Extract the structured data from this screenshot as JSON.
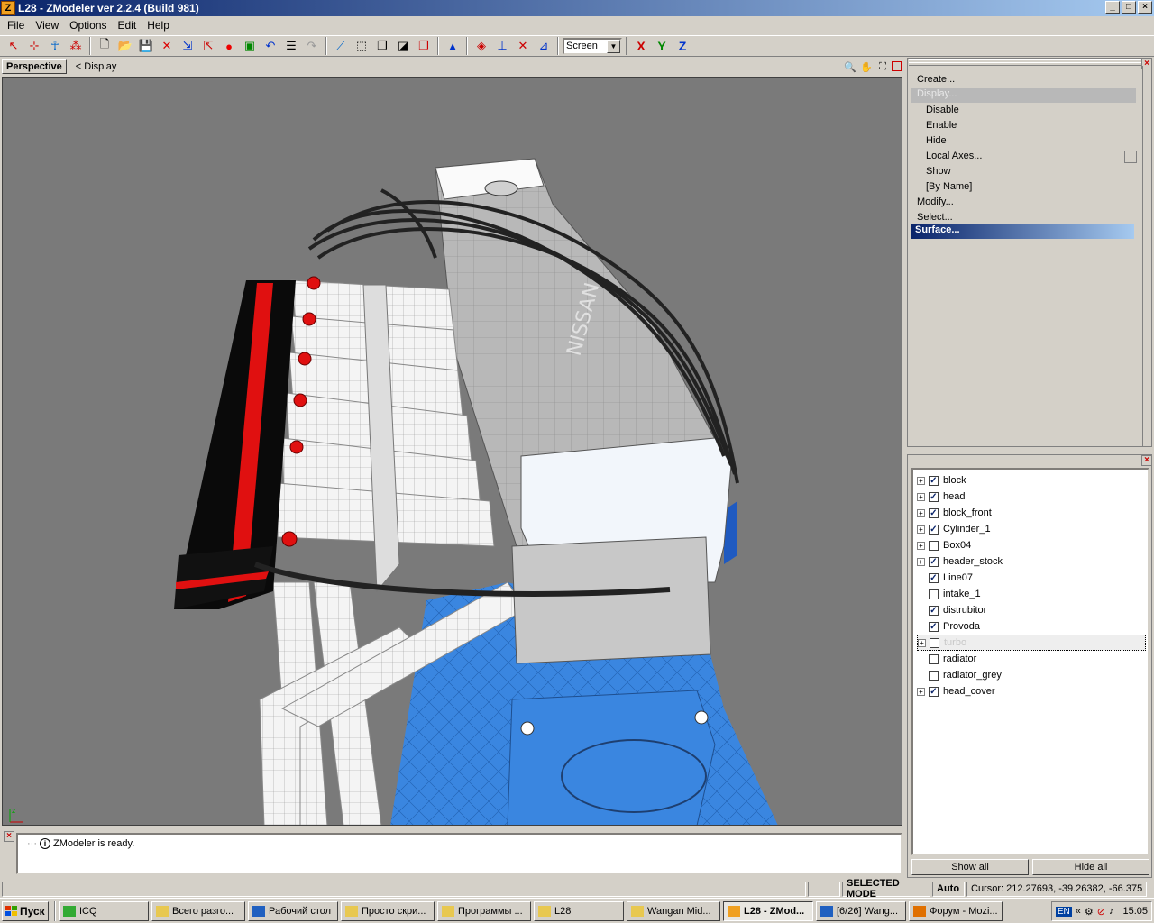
{
  "window": {
    "title": "L28 - ZModeler ver 2.2.4 (Build 981)",
    "app_icon": "Z"
  },
  "menubar": [
    "File",
    "View",
    "Options",
    "Edit",
    "Help"
  ],
  "toolbar": {
    "view_combo": "Screen",
    "axis_x": "X",
    "axis_y": "Y",
    "axis_z": "Z"
  },
  "viewport": {
    "tab": "Perspective",
    "crumb": "<  Display"
  },
  "command_panel": {
    "items": [
      {
        "label": "Create...",
        "indent": false
      },
      {
        "label": "Display...",
        "indent": false,
        "dim": true
      },
      {
        "label": "Disable",
        "indent": true
      },
      {
        "label": "Enable",
        "indent": true
      },
      {
        "label": "Hide",
        "indent": true
      },
      {
        "label": "Local Axes...",
        "indent": true
      },
      {
        "label": "Show",
        "indent": true
      },
      {
        "label": "[By Name]",
        "indent": true
      },
      {
        "label": "Modify...",
        "indent": false
      },
      {
        "label": "Select...",
        "indent": false
      },
      {
        "label": "Surface...",
        "indent": false,
        "selected": true
      }
    ]
  },
  "objects": [
    {
      "name": "block",
      "expand": true,
      "checked": true
    },
    {
      "name": "head",
      "expand": true,
      "checked": true
    },
    {
      "name": "block_front",
      "expand": true,
      "checked": true
    },
    {
      "name": "Cylinder_1",
      "expand": true,
      "checked": true
    },
    {
      "name": "Box04",
      "expand": true,
      "checked": false
    },
    {
      "name": "header_stock",
      "expand": true,
      "checked": true
    },
    {
      "name": "Line07",
      "expand": false,
      "checked": true
    },
    {
      "name": "intake_1",
      "expand": false,
      "checked": false
    },
    {
      "name": "distrubitor",
      "expand": false,
      "checked": true
    },
    {
      "name": "Provoda",
      "expand": false,
      "checked": true
    },
    {
      "name": "turbo",
      "expand": true,
      "checked": false,
      "faded": true
    },
    {
      "name": "radiator",
      "expand": false,
      "checked": false
    },
    {
      "name": "radiator_grey",
      "expand": false,
      "checked": false
    },
    {
      "name": "head_cover",
      "expand": true,
      "checked": true
    }
  ],
  "buttons": {
    "show_all": "Show all",
    "hide_all": "Hide all"
  },
  "log": {
    "message": "ZModeler is ready."
  },
  "status": {
    "mode": "SELECTED MODE",
    "auto": "Auto",
    "cursor": "Cursor: 212.27693, -39.26382, -66.375"
  },
  "taskbar": {
    "start": "Пуск",
    "buttons": [
      {
        "label": "ICQ"
      },
      {
        "label": "Всего разго..."
      },
      {
        "label": "Рабочий стол"
      },
      {
        "label": "Просто скри..."
      },
      {
        "label": "Программы ..."
      },
      {
        "label": "L28"
      },
      {
        "label": "Wangan Mid..."
      },
      {
        "label": "L28 - ZMod...",
        "active": true
      },
      {
        "label": "[6/26] Wang..."
      },
      {
        "label": "Форум - Mozi..."
      }
    ],
    "lang": "EN",
    "clock": "15:05"
  },
  "colors": {
    "title_start": "#0a246a",
    "title_end": "#a6caf0",
    "viewport_bg": "#7a7a7a",
    "engine_blue": "#3a86e0",
    "belt_red": "#e01010"
  }
}
